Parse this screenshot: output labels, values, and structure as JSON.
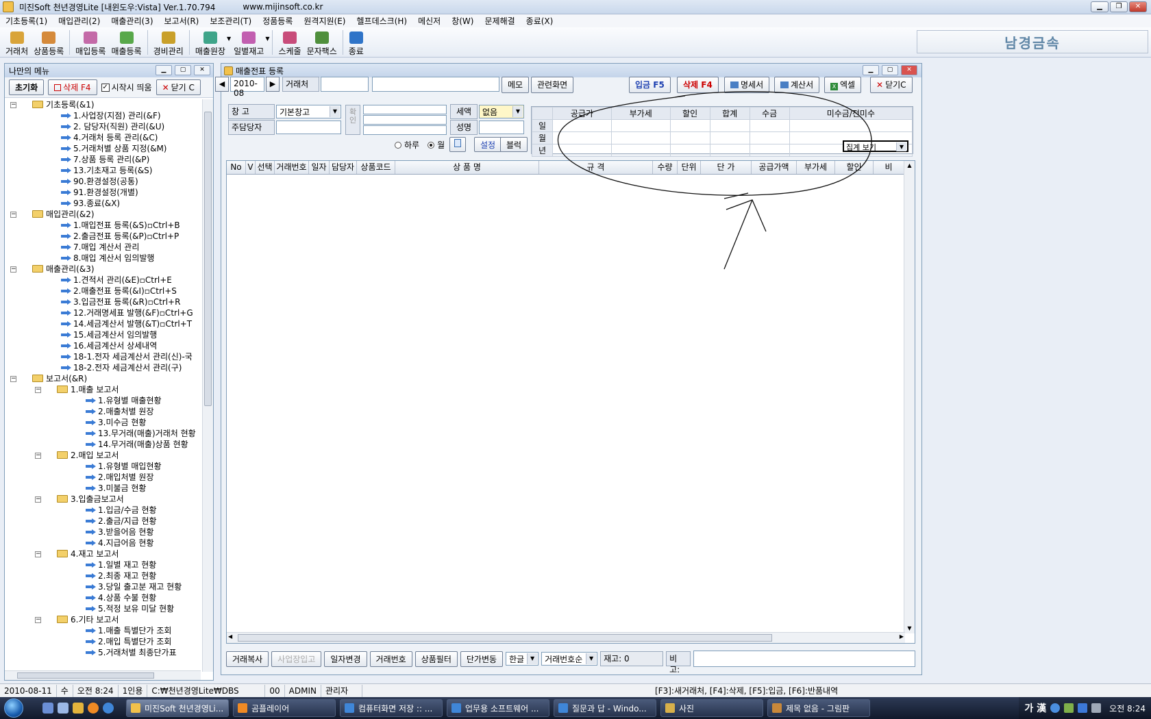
{
  "window": {
    "title": "미진Soft 천년경영Lite [내윈도우:Vista] Ver.1.70.794",
    "url": "www.mijinsoft.co.kr"
  },
  "menu": [
    "기초등록(1)",
    "매입관리(2)",
    "매출관리(3)",
    "보고서(R)",
    "보조관리(T)",
    "정품등록",
    "원격지원(E)",
    "헬프데스크(H)",
    "메신저",
    "창(W)",
    "문제해결",
    "종료(X)"
  ],
  "toolbar": [
    {
      "label": "거래처",
      "icon": "people-icon",
      "color": "#d9a43a"
    },
    {
      "label": "상품등록",
      "icon": "box-icon",
      "color": "#d58a3b"
    },
    {
      "label": "매입등록",
      "icon": "purchase-icon",
      "color": "#c46aa8"
    },
    {
      "label": "매출등록",
      "icon": "sales-icon",
      "color": "#58a84a"
    },
    {
      "label": "경비관리",
      "icon": "coins-icon",
      "color": "#c9a02a"
    },
    {
      "label": "매출원장",
      "icon": "ledger-icon",
      "color": "#3fa58a"
    },
    {
      "label": "일별재고",
      "icon": "stock-icon",
      "color": "#c25fb0"
    },
    {
      "label": "스케줄",
      "icon": "schedule-icon",
      "color": "#c84c7a"
    },
    {
      "label": "문자팩스",
      "icon": "phone-icon",
      "color": "#4f8f3c"
    },
    {
      "label": "종료",
      "icon": "exit-icon",
      "color": "#2f74c8"
    }
  ],
  "company": "남경금속",
  "left_panel": {
    "title": "나만의 메뉴",
    "reset": "초기화",
    "delete": "삭제 F4",
    "startup": "시작시 띄움",
    "close": "닫기 C",
    "tree": [
      {
        "t": "기초등록(&1)",
        "lvl": 0,
        "folder": true
      },
      {
        "t": "1.사업장(지점) 관리(&F)",
        "lvl": 1
      },
      {
        "t": "2. 담당자(직원) 관리(&U)",
        "lvl": 1
      },
      {
        "t": "4.거래처 등록 관리(&C)",
        "lvl": 1
      },
      {
        "t": "5.거래처별 상품 지정(&M)",
        "lvl": 1
      },
      {
        "t": "7.상품 등록 관리(&P)",
        "lvl": 1
      },
      {
        "t": "13.기초재고 등록(&S)",
        "lvl": 1
      },
      {
        "t": "90.환경설정(공통)",
        "lvl": 1
      },
      {
        "t": "91.환경설정(개별)",
        "lvl": 1
      },
      {
        "t": "93.종료(&X)",
        "lvl": 1
      },
      {
        "t": "매입관리(&2)",
        "lvl": 0,
        "folder": true
      },
      {
        "t": "1.매입전표 등록(&S)▫Ctrl+B",
        "lvl": 1
      },
      {
        "t": "2.출금전표 등록(&P)▫Ctrl+P",
        "lvl": 1
      },
      {
        "t": "7.매입 계산서 관리",
        "lvl": 1
      },
      {
        "t": "8.매입 계산서 임의발행",
        "lvl": 1
      },
      {
        "t": "매출관리(&3)",
        "lvl": 0,
        "folder": true
      },
      {
        "t": "1.견적서 관리(&E)▫Ctrl+E",
        "lvl": 1
      },
      {
        "t": "2.매출전표 등록(&I)▫Ctrl+S",
        "lvl": 1
      },
      {
        "t": "3.입금전표 등록(&R)▫Ctrl+R",
        "lvl": 1
      },
      {
        "t": "12.거래명세표 발행(&F)▫Ctrl+G",
        "lvl": 1
      },
      {
        "t": "14.세금계산서 발행(&T)▫Ctrl+T",
        "lvl": 1
      },
      {
        "t": "15.세금계산서 임의발행",
        "lvl": 1
      },
      {
        "t": "16.세금계산서 상세내역",
        "lvl": 1
      },
      {
        "t": "18-1.전자 세금계산서 관리(신)-국",
        "lvl": 1
      },
      {
        "t": "18-2.전자 세금계산서 관리(구)",
        "lvl": 1
      },
      {
        "t": "보고서(&R)",
        "lvl": 0,
        "folder": true
      },
      {
        "t": "1.매출 보고서",
        "lvl": 1,
        "folder": true
      },
      {
        "t": "1.유형별  매출현황",
        "lvl": 2
      },
      {
        "t": "2.매출처별 원장",
        "lvl": 2
      },
      {
        "t": "3.미수금 현황",
        "lvl": 2
      },
      {
        "t": "13.무거래(매출)거래처 현황",
        "lvl": 2
      },
      {
        "t": "14.무거래(매출)상품 현황",
        "lvl": 2
      },
      {
        "t": "2.매입 보고서",
        "lvl": 1,
        "folder": true
      },
      {
        "t": "1.유형별  매입현황",
        "lvl": 2
      },
      {
        "t": "2.매입처별 원장",
        "lvl": 2
      },
      {
        "t": "3.미불금 현황",
        "lvl": 2
      },
      {
        "t": "3.입출금보고서",
        "lvl": 1,
        "folder": true
      },
      {
        "t": "1.입금/수금 현황",
        "lvl": 2
      },
      {
        "t": "2.출금/지급 현황",
        "lvl": 2
      },
      {
        "t": "3.받을어음 현황",
        "lvl": 2
      },
      {
        "t": "4.지급어음 현황",
        "lvl": 2
      },
      {
        "t": "4.재고 보고서",
        "lvl": 1,
        "folder": true
      },
      {
        "t": "1.일별 재고 현황",
        "lvl": 2
      },
      {
        "t": "2.최종 재고 현황",
        "lvl": 2
      },
      {
        "t": "3.당일 출고분 재고 현황",
        "lvl": 2
      },
      {
        "t": "4.상품 수불 현황",
        "lvl": 2
      },
      {
        "t": "5.적정 보유 미달 현황",
        "lvl": 2
      },
      {
        "t": "6.기타 보고서",
        "lvl": 1,
        "folder": true
      },
      {
        "t": "1.매출 특별단가 조회",
        "lvl": 2
      },
      {
        "t": "2.매입 특별단가 조회",
        "lvl": 2
      },
      {
        "t": "5.거래처별 최종단가표",
        "lvl": 2
      }
    ]
  },
  "main": {
    "title": "매출전표 등록",
    "date": "2010-08",
    "client_label": "거래처",
    "memo": "메모",
    "related": "관련화면",
    "actions": [
      "입금 F5",
      "삭제 F4",
      "명세서",
      "계산서",
      "엑셀",
      "닫기C"
    ],
    "warehouse_label": "창   고",
    "warehouse_value": "기본창고",
    "manager_label": "주담당자",
    "confirm_label": "확인",
    "tax_label": "세액",
    "tax_value": "없음",
    "name_label": "성명",
    "radio_day": "하루",
    "radio_month": "월",
    "settings": "설정",
    "block": "블럭",
    "summary_headers": [
      "공급가",
      "부가세",
      "할인",
      "합계",
      "수금",
      "미수금/전미수"
    ],
    "summary_rows": [
      "일",
      "월",
      "년"
    ],
    "summary_select": "집계 보기",
    "grid_headers": [
      "No",
      "V",
      "선택",
      "거래번호",
      "일자",
      "담당자",
      "상품코드",
      "상 품 명",
      "규 격",
      "수량",
      "단위",
      "단 가",
      "공급가액",
      "부가세",
      "할인",
      "비"
    ],
    "bottom": {
      "copy": "거래복사",
      "site_in": "사업장입고",
      "date_change": "일자변경",
      "deal_no": "거래번호",
      "filter": "상품필터",
      "price_change": "단가변동",
      "lang": "한글",
      "sort": "거래번호순",
      "stock": "재고: 0",
      "note_label": "비고:"
    }
  },
  "status": {
    "date": "2010-08-11",
    "weekday": "수",
    "time": "오전 8:24",
    "users": "1인용",
    "path": "C:₩천년경영Lite₩DBS",
    "code": "00",
    "user": "ADMIN",
    "role": "관리자",
    "hint": "[F3]:새거래처, [F4]:삭제, [F5]:입금, [F6]:반품내역"
  },
  "taskbar": {
    "tasks": [
      "미진Soft 천년경영Li...",
      "곰플레이어",
      "컴퓨터화면 저장 :: ...",
      "업무용 소프트웨어 ...",
      "질문과 답 - Windo...",
      "사진",
      "제목 없음 - 그림판"
    ],
    "ime": "가 漢",
    "clock": "오전 8:24"
  }
}
